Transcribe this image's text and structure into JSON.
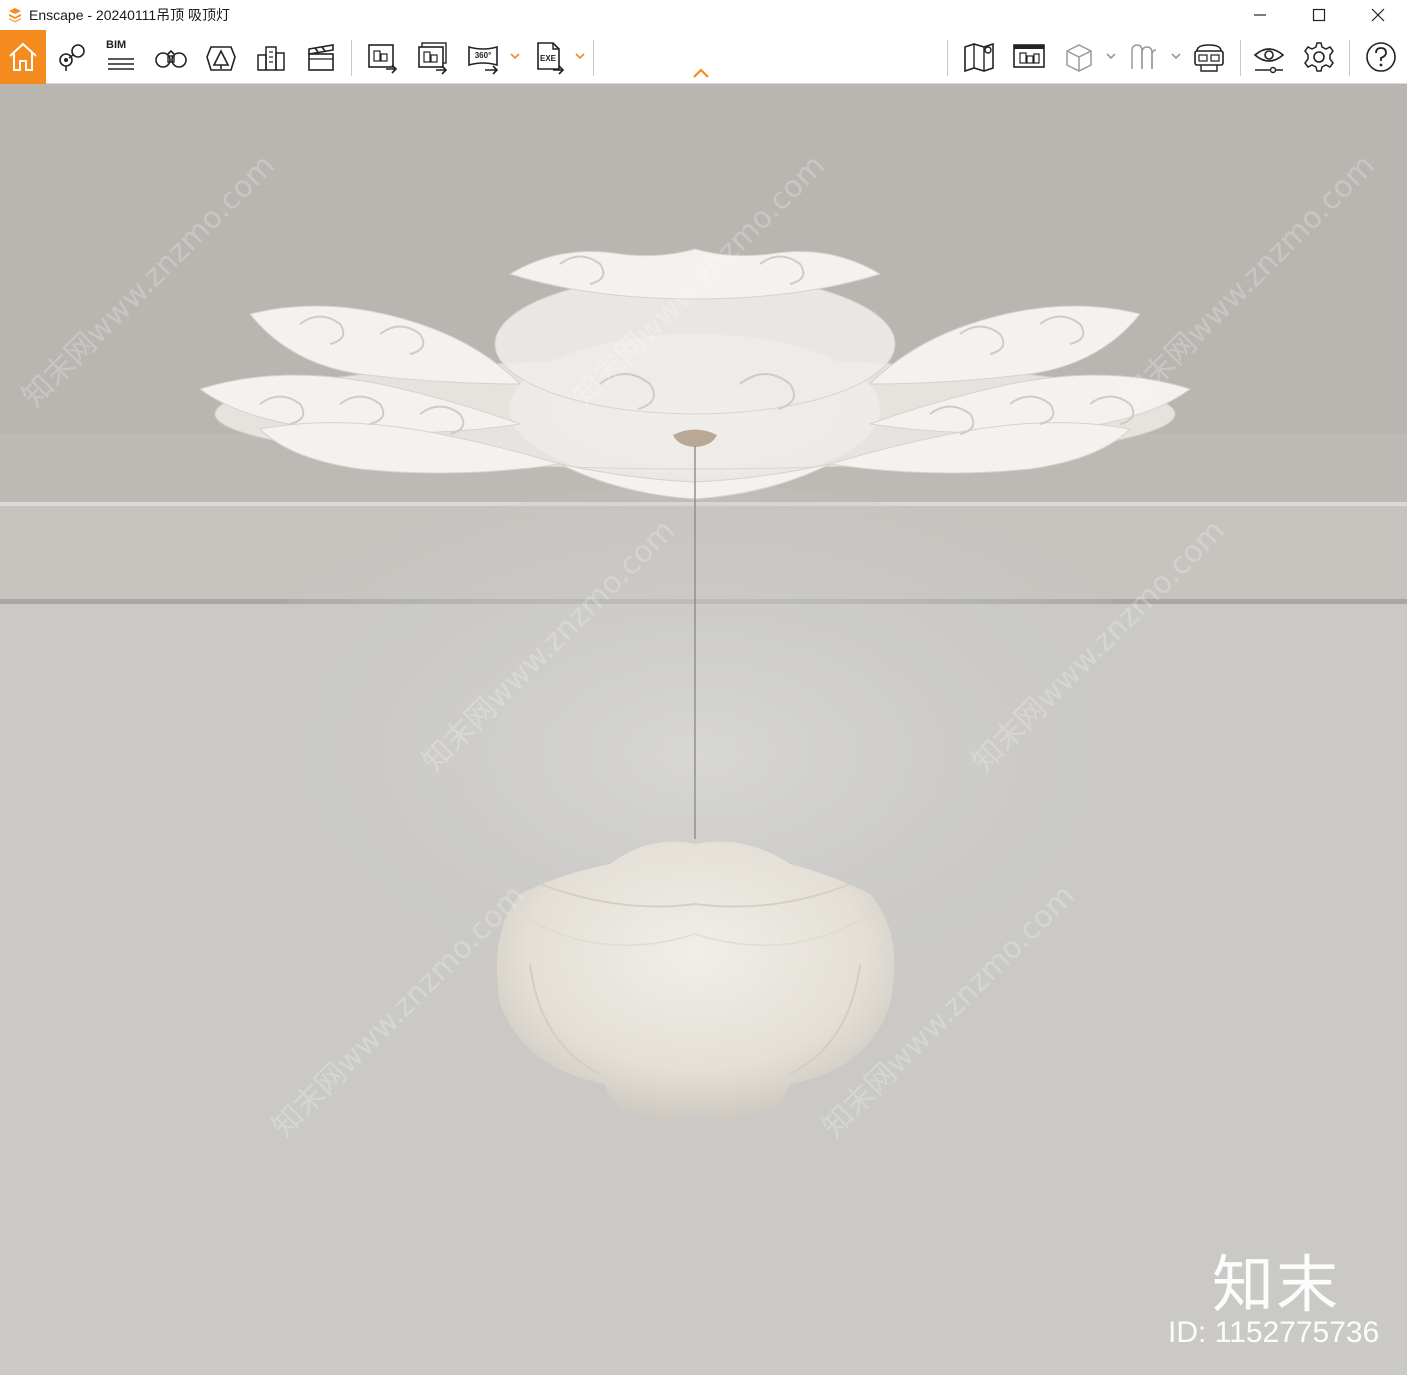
{
  "window": {
    "title": "Enscape - 20240111吊顶 吸顶灯",
    "controls": [
      "minimize",
      "maximize",
      "close"
    ]
  },
  "toolbar": {
    "left_tools": [
      {
        "name": "home",
        "icon": "home-icon"
      },
      {
        "name": "views",
        "icon": "location-pin-icon"
      },
      {
        "name": "bim",
        "icon": "bim-icon",
        "label": "BIM"
      },
      {
        "name": "binoculars",
        "icon": "binoculars-icon"
      },
      {
        "name": "assets",
        "icon": "asset-library-icon"
      },
      {
        "name": "buildings",
        "icon": "city-icon"
      },
      {
        "name": "video",
        "icon": "clapperboard-icon"
      },
      {
        "name": "export-image",
        "icon": "export-image-icon"
      },
      {
        "name": "batch-export",
        "icon": "batch-export-icon"
      },
      {
        "name": "panorama",
        "icon": "panorama-360-icon",
        "label": "360°"
      },
      {
        "name": "exe-export",
        "icon": "exe-export-icon",
        "label": "EXE"
      }
    ],
    "right_tools": [
      {
        "name": "map",
        "icon": "map-icon"
      },
      {
        "name": "billboard",
        "icon": "billboard-icon"
      },
      {
        "name": "cube",
        "icon": "cube-icon"
      },
      {
        "name": "materials",
        "icon": "material-icon"
      },
      {
        "name": "vr",
        "icon": "vr-headset-icon"
      },
      {
        "name": "visual-settings",
        "icon": "eye-settings-icon"
      },
      {
        "name": "settings",
        "icon": "gear-icon"
      },
      {
        "name": "help",
        "icon": "help-icon",
        "label": "?"
      }
    ],
    "accent_color": "#f38b1e"
  },
  "viewport": {
    "watermark_text": "知末网www.znzmo.com",
    "watermark_logo": "知末",
    "watermark_id": "ID: 1152775736"
  }
}
